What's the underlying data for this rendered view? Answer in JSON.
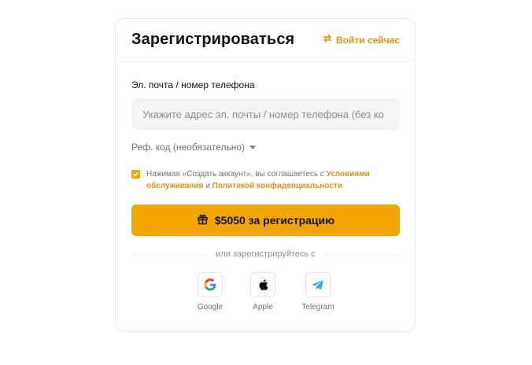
{
  "header": {
    "title": "Зарегистрироваться",
    "login_link": "Войти сейчас"
  },
  "form": {
    "email_label": "Эл. почта / номер телефона",
    "email_placeholder": "Укажите адрес эл. почты / номер телефона (без ко",
    "email_value": "",
    "referral_label": "Реф. код (необязательно)",
    "agreement": {
      "checked": true,
      "prefix": "Нажимая «Создать аккаунт», вы соглашаетесь с ",
      "terms_link": "Условиями обслуживания",
      "middle": " и ",
      "privacy_link": "Политикой конфиденциальности"
    },
    "submit_label": "$5050 за регистрацию"
  },
  "social": {
    "divider_text": "или зарегистрируйтесь с",
    "providers": [
      {
        "label": "Google",
        "icon": "google-icon"
      },
      {
        "label": "Apple",
        "icon": "apple-icon"
      },
      {
        "label": "Telegram",
        "icon": "telegram-icon"
      }
    ]
  },
  "colors": {
    "accent": "#f0a500",
    "link": "#d9940f",
    "muted_text": "#6d7178",
    "input_bg": "#f4f4f5",
    "telegram": "#2aabee"
  }
}
